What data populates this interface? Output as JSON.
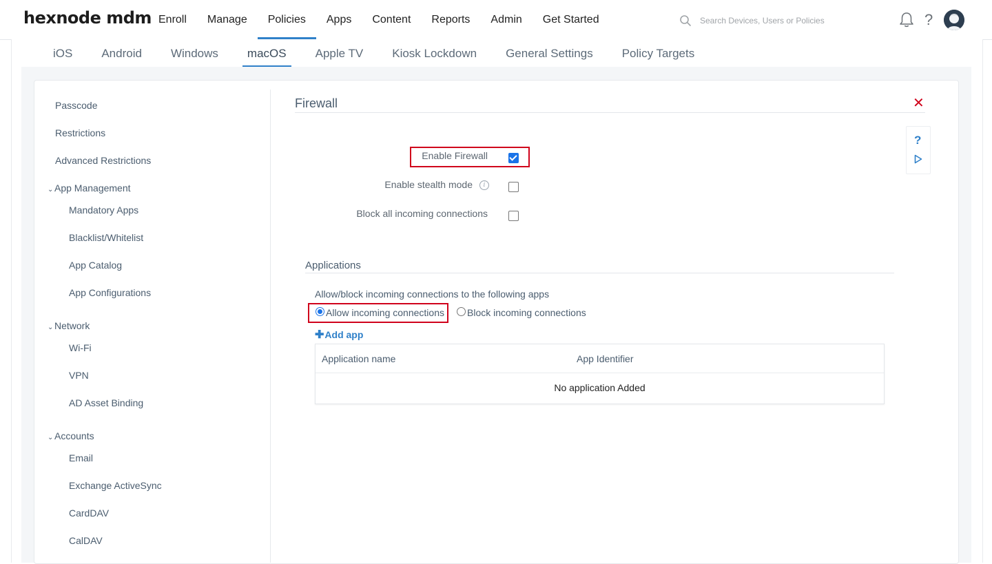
{
  "brand": {
    "logo_text": "hexnode mdm"
  },
  "main_nav": {
    "items": [
      "Enroll",
      "Manage",
      "Policies",
      "Apps",
      "Content",
      "Reports",
      "Admin",
      "Get Started"
    ],
    "active": "Policies"
  },
  "search": {
    "placeholder": "Search Devices, Users or Policies"
  },
  "sub_nav": {
    "tabs": [
      "iOS",
      "Android",
      "Windows",
      "macOS",
      "Apple TV",
      "Kiosk Lockdown",
      "General Settings",
      "Policy Targets"
    ],
    "active": "macOS"
  },
  "sidebar": {
    "items": [
      {
        "label": "Passcode"
      },
      {
        "label": "Restrictions"
      },
      {
        "label": "Advanced Restrictions"
      },
      {
        "label": "App Management",
        "group": true
      },
      {
        "label": "Mandatory Apps"
      },
      {
        "label": "Blacklist/Whitelist"
      },
      {
        "label": "App Catalog"
      },
      {
        "label": "App Configurations"
      },
      {
        "label": "Network",
        "group": true
      },
      {
        "label": "Wi-Fi"
      },
      {
        "label": "VPN"
      },
      {
        "label": "AD Asset Binding"
      },
      {
        "label": "Accounts",
        "group": true
      },
      {
        "label": "Email"
      },
      {
        "label": "Exchange ActiveSync"
      },
      {
        "label": "CardDAV"
      },
      {
        "label": "CalDAV"
      }
    ]
  },
  "firewall": {
    "title": "Firewall",
    "enable_firewall_label": "Enable Firewall",
    "enable_firewall_checked": true,
    "stealth_mode_label": "Enable stealth mode",
    "stealth_mode_checked": false,
    "block_all_label": "Block all incoming connections",
    "block_all_checked": false
  },
  "applications": {
    "title": "Applications",
    "description": "Allow/block incoming connections to the following apps",
    "allow_label": "Allow incoming connections",
    "block_label": "Block incoming connections",
    "selected": "allow",
    "add_app_label": "Add app",
    "table": {
      "columns": [
        "Application name",
        "App Identifier"
      ],
      "empty_text": "No application Added"
    }
  },
  "colors": {
    "accent": "#2f80c9",
    "highlight_box": "#d0021b",
    "close": "#d0021b"
  }
}
